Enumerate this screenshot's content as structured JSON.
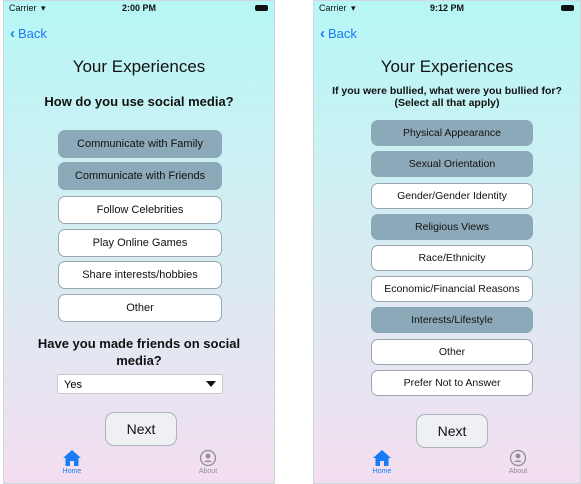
{
  "colors": {
    "accent": "#1a7bf5",
    "selected_option": "#8ca9b9",
    "tab_inactive": "#8e8e93"
  },
  "left": {
    "status": {
      "carrier": "Carrier",
      "time": "2:00 PM"
    },
    "back_label": "Back",
    "title": "Your Experiences",
    "question": "How do you use social media?",
    "options": [
      {
        "label": "Communicate with Family",
        "selected": true
      },
      {
        "label": "Communicate with Friends",
        "selected": true
      },
      {
        "label": "Follow Celebrities",
        "selected": false
      },
      {
        "label": "Play Online Games",
        "selected": false
      },
      {
        "label": "Share interests/hobbies",
        "selected": false
      },
      {
        "label": "Other",
        "selected": false
      }
    ],
    "question2": "Have you made friends on social media?",
    "dropdown_value": "Yes",
    "next_label": "Next",
    "tabs": {
      "home": "Home",
      "about": "About"
    }
  },
  "right": {
    "status": {
      "carrier": "Carrier",
      "time": "9:12 PM"
    },
    "back_label": "Back",
    "title": "Your Experiences",
    "question": "If you were bullied, what were you bullied for? (Select all that apply)",
    "options": [
      {
        "label": "Physical Appearance",
        "selected": true
      },
      {
        "label": "Sexual Orientation",
        "selected": true
      },
      {
        "label": "Gender/Gender Identity",
        "selected": false
      },
      {
        "label": "Religious Views",
        "selected": true
      },
      {
        "label": "Race/Ethnicity",
        "selected": false
      },
      {
        "label": "Economic/Financial Reasons",
        "selected": false
      },
      {
        "label": "Interests/Lifestyle",
        "selected": true
      },
      {
        "label": "Other",
        "selected": false
      },
      {
        "label": "Prefer Not to Answer",
        "selected": false
      }
    ],
    "next_label": "Next",
    "tabs": {
      "home": "Home",
      "about": "About"
    }
  }
}
